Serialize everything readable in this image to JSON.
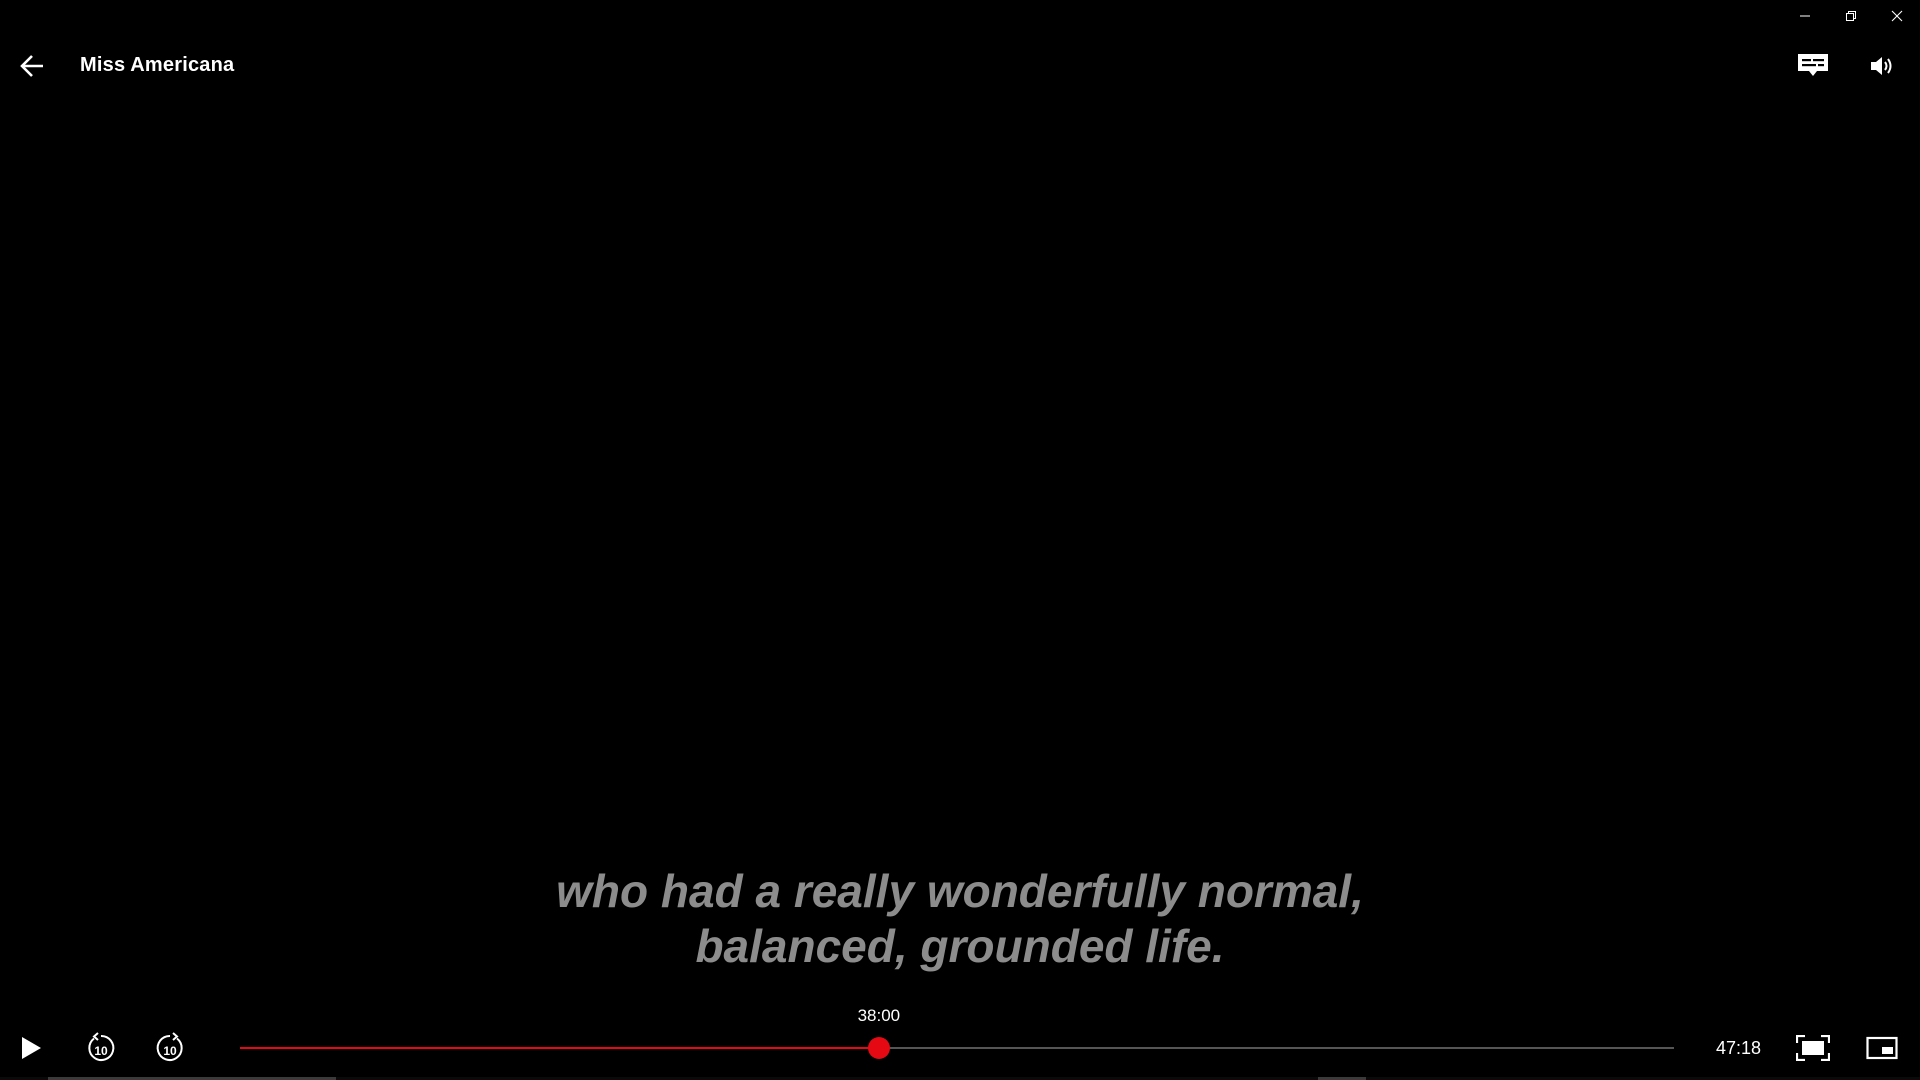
{
  "window": {
    "minimize_icon": "minimize-icon",
    "restore_icon": "restore-icon",
    "close_icon": "close-icon"
  },
  "header": {
    "title": "Miss Americana",
    "back_icon": "arrow-left-icon",
    "subtitles_icon": "subtitles-icon",
    "volume_icon": "volume-icon"
  },
  "subtitle": {
    "lines": [
      "who had a really wonderfully normal,",
      "balanced, grounded life."
    ]
  },
  "player": {
    "current_time": "38:00",
    "duration": "47:18",
    "progress": 0.4455,
    "accent_color": "#e50914",
    "play_icon": "play-icon",
    "rewind_icon": "rewind-10-icon",
    "forward_icon": "forward-10-icon",
    "skip_seconds": "10",
    "fullscreen_icon": "fullscreen-icon",
    "pip_icon": "picture-in-picture-icon"
  }
}
